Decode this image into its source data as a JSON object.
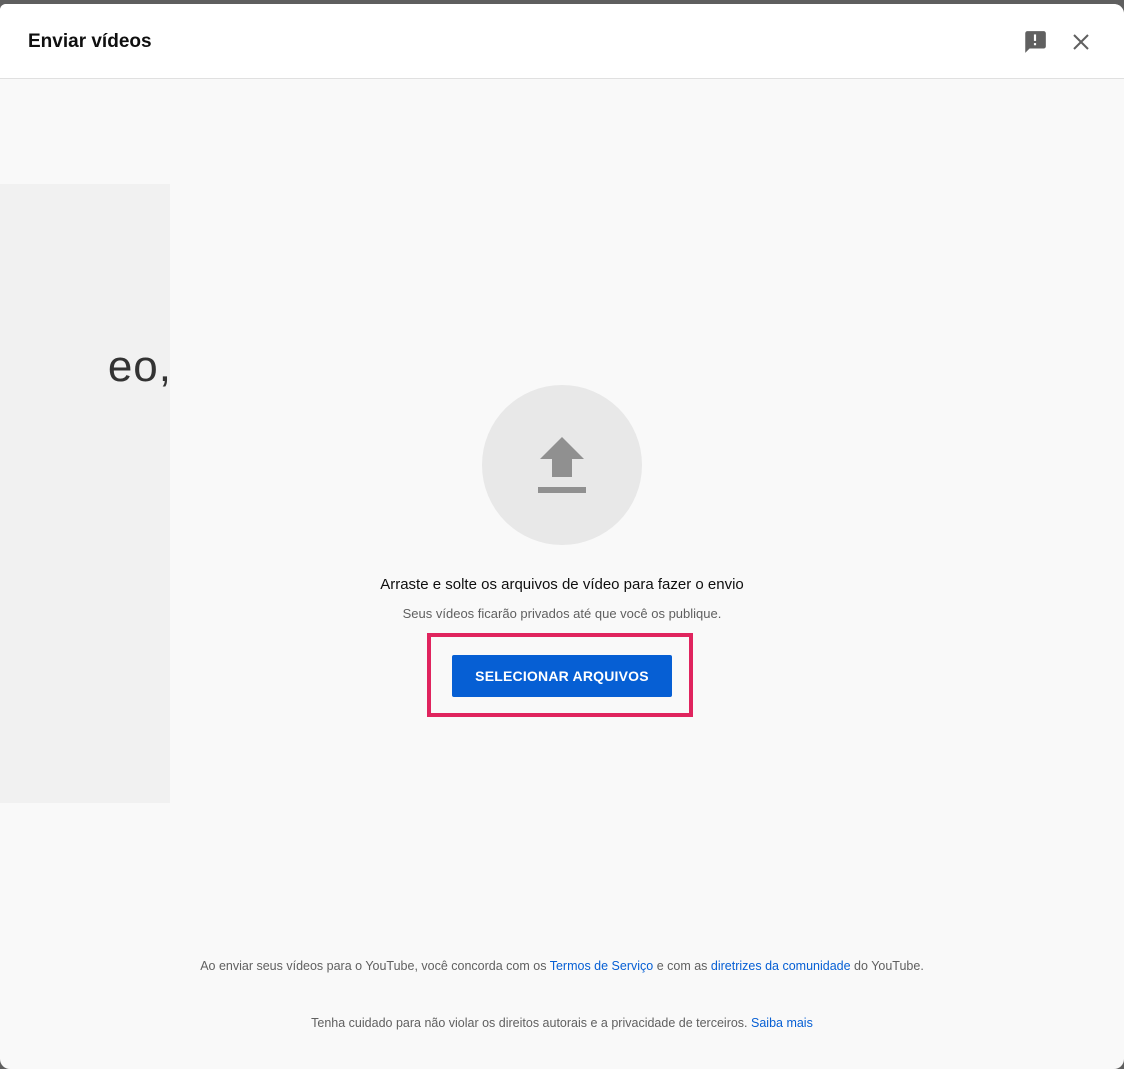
{
  "dialog": {
    "title": "Enviar vídeos",
    "feedback_icon": "feedback-icon",
    "close_icon": "close-icon"
  },
  "left_panel": {
    "text": "eo,"
  },
  "upload": {
    "icon": "upload-arrow-icon",
    "drag_text": "Arraste e solte os arquivos de vídeo para fazer o envio",
    "private_text": "Seus vídeos ficarão privados até que você os publique.",
    "select_button_label": "SELECIONAR ARQUIVOS",
    "highlight_color": "#e0245e",
    "button_color": "#065fd4"
  },
  "footer": {
    "line1_prefix": "Ao enviar seus vídeos para o YouTube, você concorda com os ",
    "terms_link": "Termos de Serviço",
    "line1_middle": " e com as ",
    "guidelines_link": "diretrizes da comunidade",
    "line1_suffix": " do YouTube.",
    "line2_prefix": "Tenha cuidado para não violar os direitos autorais e a privacidade de terceiros. ",
    "learn_more_link": "Saiba mais"
  }
}
